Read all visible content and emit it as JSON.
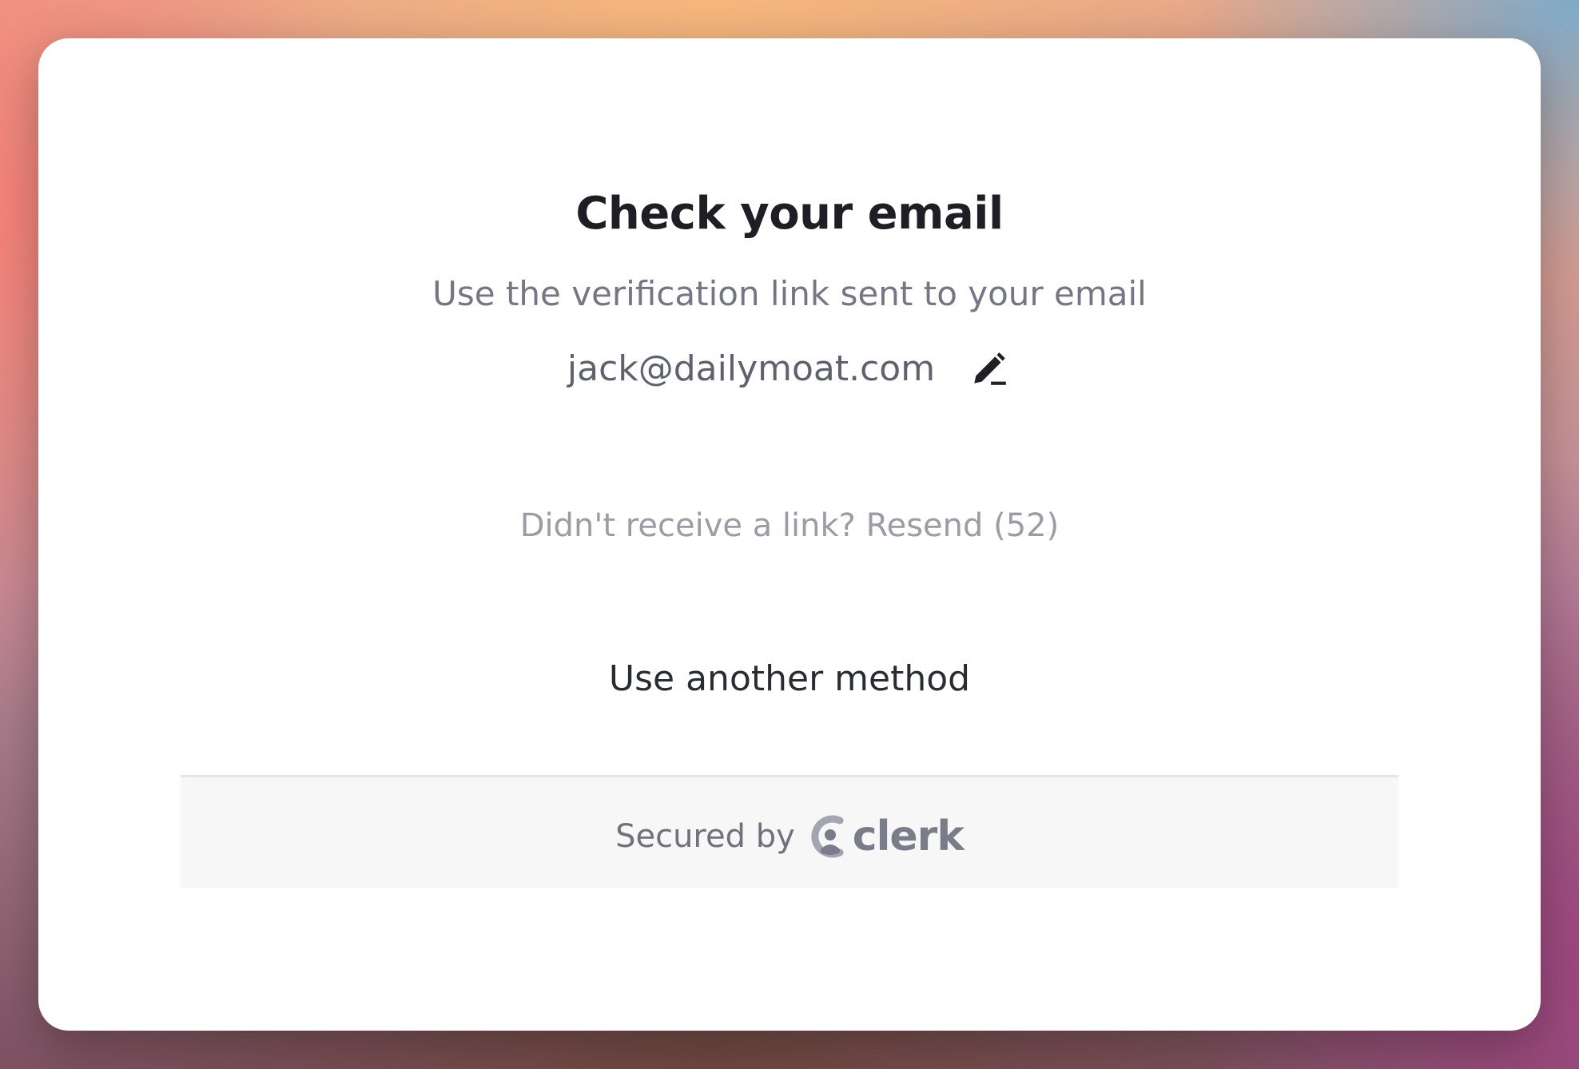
{
  "dialog": {
    "title": "Check your email",
    "subtitle": "Use the verification link sent to your email",
    "email": "jack@dailymoat.com",
    "edit_icon": "pencil-icon",
    "resend_text": "Didn't receive a link? Resend (52)",
    "alternate_method_label": "Use another method"
  },
  "footer": {
    "secured_by": "Secured by",
    "brand_name": "clerk",
    "brand_icon": "clerk-logo-icon"
  },
  "colors": {
    "title": "#1d1f24",
    "subtitle": "#747686",
    "muted": "#9a9ca6",
    "footer_bg": "#f7f7f8",
    "brand": "#7a7c89"
  }
}
